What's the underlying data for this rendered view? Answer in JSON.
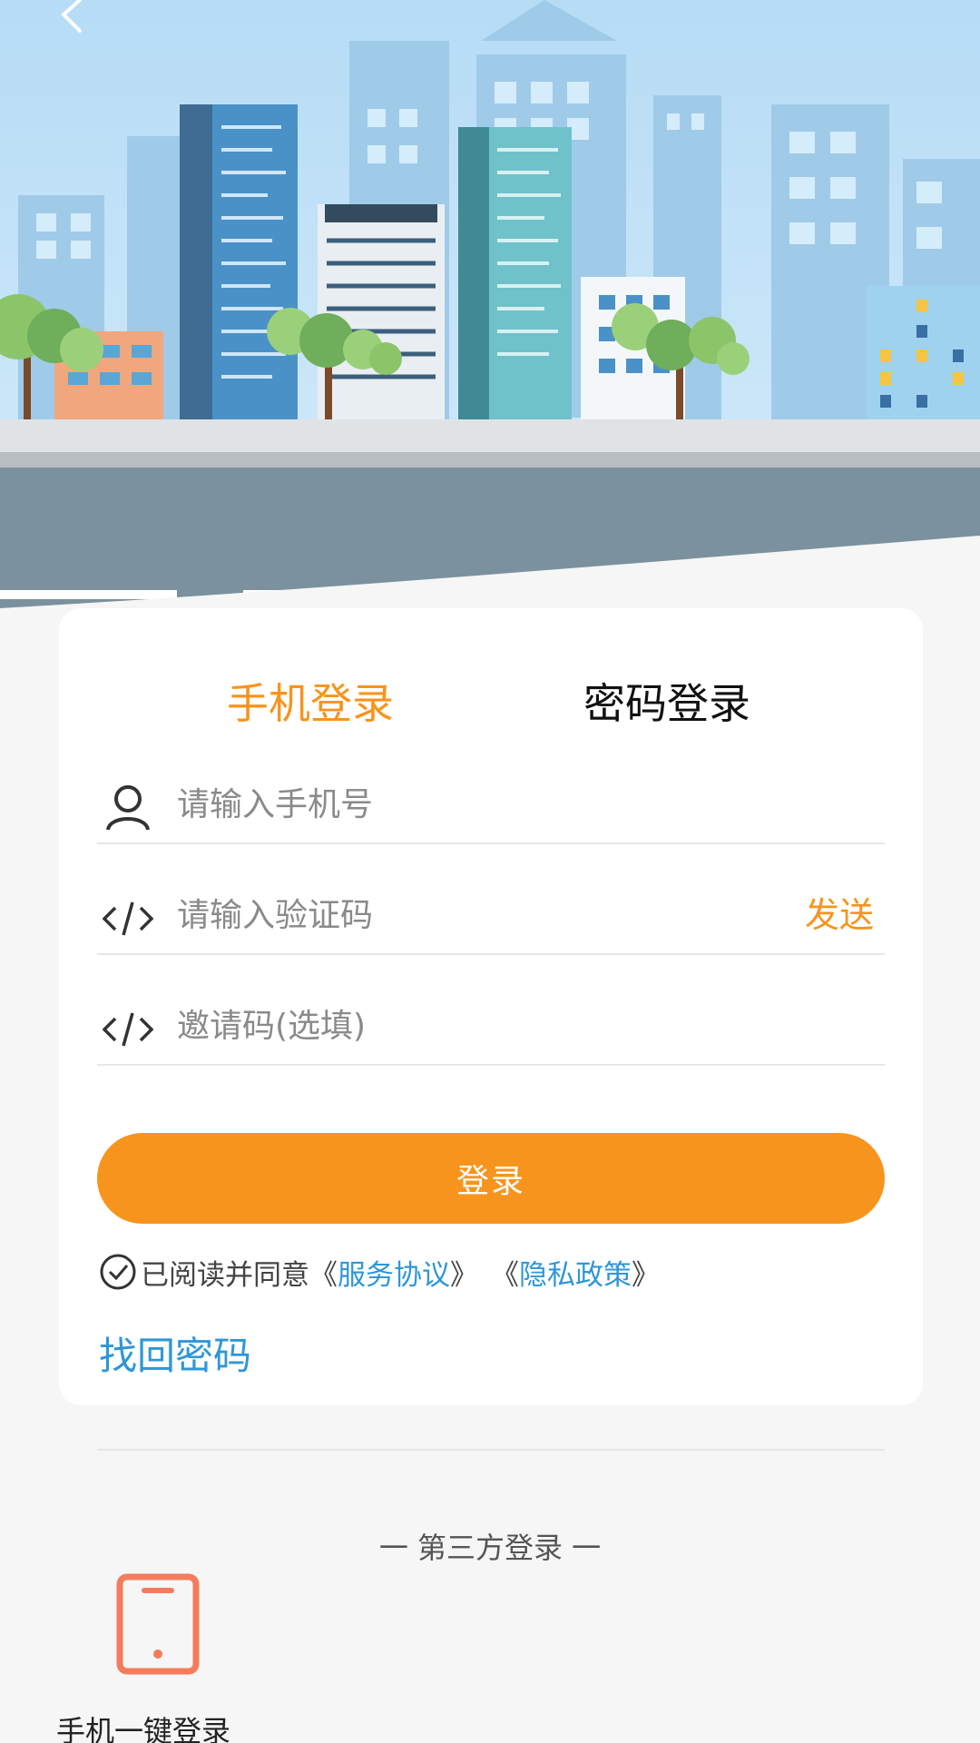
{
  "header": {
    "back_icon": "chevron-left-icon"
  },
  "tabs": [
    {
      "label": "手机登录",
      "active": true
    },
    {
      "label": "密码登录",
      "active": false
    }
  ],
  "form": {
    "phone": {
      "placeholder": "请输入手机号",
      "value": "",
      "icon": "user-icon"
    },
    "code": {
      "placeholder": "请输入验证码",
      "value": "",
      "icon": "code-icon",
      "send_label": "发送"
    },
    "invite": {
      "placeholder": "邀请码(选填)",
      "value": "",
      "icon": "code-icon"
    },
    "submit_label": "登录"
  },
  "agreement": {
    "prefix": "已阅读并同意",
    "open1": "《",
    "link1": "服务协议",
    "close1": "》",
    "open2": "《",
    "link2": "隐私政策",
    "close2": "》"
  },
  "recover_label": "找回密码",
  "third_party": {
    "title": "一 第三方登录 一",
    "items": [
      {
        "label": "手机一键登录",
        "icon": "smartphone-icon"
      }
    ]
  },
  "colors": {
    "accent": "#f7941d",
    "link": "#2f97d6",
    "background": "#f6f6f6",
    "phone_icon": "#f47c5c"
  }
}
